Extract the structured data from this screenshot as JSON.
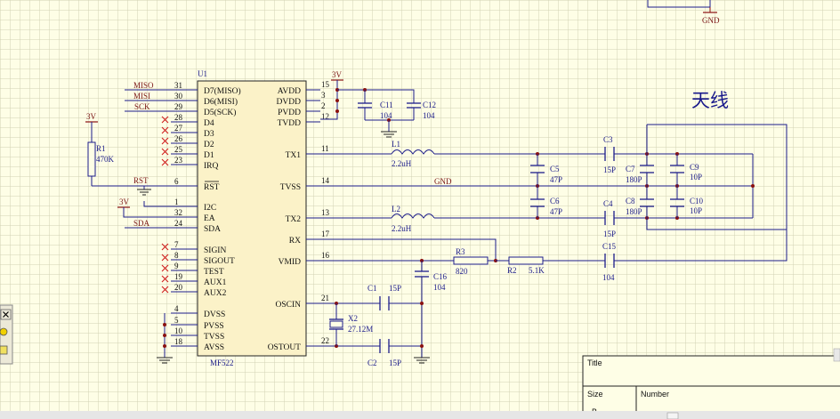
{
  "chip": {
    "ref": "U1",
    "part": "MF522",
    "left_pins": [
      {
        "num": "31",
        "name": "D7(MISO)"
      },
      {
        "num": "30",
        "name": "D6(MISI)"
      },
      {
        "num": "29",
        "name": "D5(SCK)"
      },
      {
        "num": "28",
        "name": "D4"
      },
      {
        "num": "27",
        "name": "D3"
      },
      {
        "num": "26",
        "name": "D2"
      },
      {
        "num": "25",
        "name": "D1"
      },
      {
        "num": "23",
        "name": "IRQ"
      },
      {
        "num": "6",
        "name": "RST"
      },
      {
        "num": "1",
        "name": "I2C"
      },
      {
        "num": "32",
        "name": "EA"
      },
      {
        "num": "24",
        "name": "SDA"
      },
      {
        "num": "7",
        "name": "SIGIN"
      },
      {
        "num": "8",
        "name": "SIGOUT"
      },
      {
        "num": "9",
        "name": "TEST"
      },
      {
        "num": "19",
        "name": "AUX1"
      },
      {
        "num": "20",
        "name": "AUX2"
      },
      {
        "num": "4",
        "name": "DVSS"
      },
      {
        "num": "5",
        "name": "PVSS"
      },
      {
        "num": "10",
        "name": "TVSS"
      },
      {
        "num": "18",
        "name": "AVSS"
      }
    ],
    "right_pins": [
      {
        "num": "15",
        "name": "AVDD"
      },
      {
        "num": "3",
        "name": "DVDD"
      },
      {
        "num": "2",
        "name": "PVDD"
      },
      {
        "num": "12",
        "name": "TVDD"
      },
      {
        "num": "11",
        "name": "TX1"
      },
      {
        "num": "14",
        "name": "TVSS"
      },
      {
        "num": "13",
        "name": "TX2"
      },
      {
        "num": "17",
        "name": "RX"
      },
      {
        "num": "16",
        "name": "VMID"
      },
      {
        "num": "21",
        "name": "OSCIN"
      },
      {
        "num": "22",
        "name": "OSTOUT"
      }
    ]
  },
  "nets": {
    "miso": "MISO",
    "misi": "MISI",
    "sck": "SCK",
    "rst": "RST",
    "sda": "SDA",
    "gnd_mid": "GND",
    "gnd_top": "GND",
    "vcc_top": "3V",
    "vcc_r1": "3V",
    "vcc_ea": "3V"
  },
  "components": {
    "r1": {
      "ref": "R1",
      "value": "470K"
    },
    "c11": {
      "ref": "C11",
      "value": "104"
    },
    "c12": {
      "ref": "C12",
      "value": "104"
    },
    "l1": {
      "ref": "L1",
      "value": "2.2uH"
    },
    "l2": {
      "ref": "L2",
      "value": "2.2uH"
    },
    "c3": {
      "ref": "C3",
      "value": "15P"
    },
    "c4": {
      "ref": "C4",
      "value": "15P"
    },
    "c5": {
      "ref": "C5",
      "value": "47P"
    },
    "c6": {
      "ref": "C6",
      "value": "47P"
    },
    "c7": {
      "ref": "C7",
      "value": "180P"
    },
    "c8": {
      "ref": "C8",
      "value": "180P"
    },
    "c9": {
      "ref": "C9",
      "value": "10P"
    },
    "c10": {
      "ref": "C10",
      "value": "10P"
    },
    "r3": {
      "ref": "R3",
      "value": "820"
    },
    "r2": {
      "ref": "R2",
      "value": "5.1K"
    },
    "c15": {
      "ref": "C15",
      "value": "104"
    },
    "c16": {
      "ref": "C16",
      "value": "104"
    },
    "c1": {
      "ref": "C1",
      "value": "15P"
    },
    "c2": {
      "ref": "C2",
      "value": "15P"
    },
    "x2": {
      "ref": "X2",
      "value": "27.12M"
    }
  },
  "antenna_label": "天线",
  "title_block": {
    "title_label": "Title",
    "size_label": "Size",
    "number_label": "Number",
    "size_value": "B"
  },
  "colors": {
    "background": "#fefee6",
    "grid": "#d2d2b4",
    "wire": "#1c1c8a",
    "net_label": "#7a1515",
    "chip_fill": "#fbf2c8",
    "no_connect": "#d02020"
  }
}
